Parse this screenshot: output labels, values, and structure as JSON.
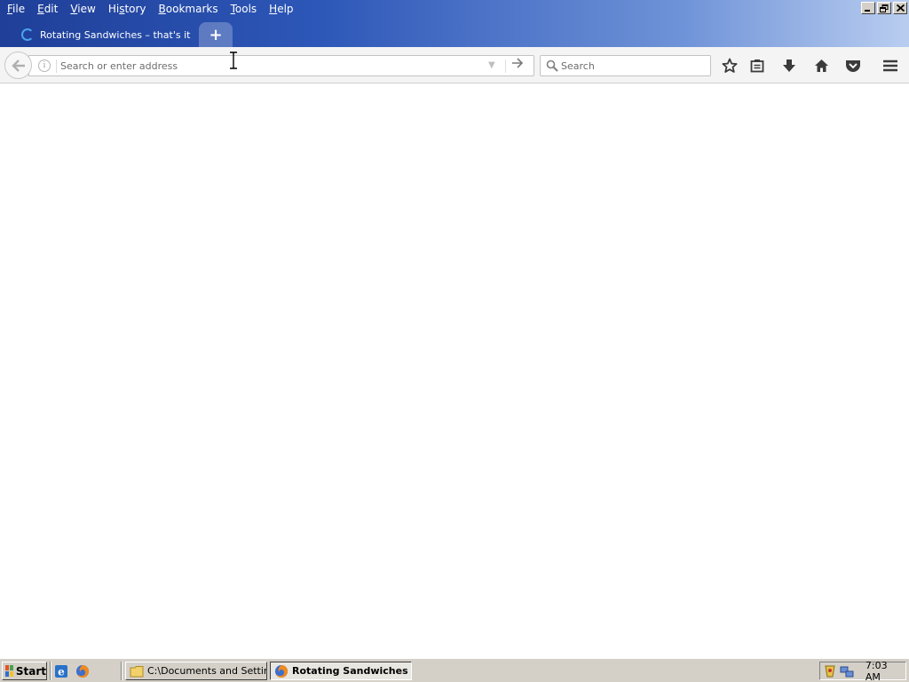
{
  "menubar": {
    "items": [
      {
        "pre": "",
        "acc": "F",
        "post": "ile"
      },
      {
        "pre": "",
        "acc": "E",
        "post": "dit"
      },
      {
        "pre": "",
        "acc": "V",
        "post": "iew"
      },
      {
        "pre": "Hi",
        "acc": "s",
        "post": "tory"
      },
      {
        "pre": "",
        "acc": "B",
        "post": "ookmarks"
      },
      {
        "pre": "",
        "acc": "T",
        "post": "ools"
      },
      {
        "pre": "",
        "acc": "H",
        "post": "elp"
      }
    ]
  },
  "tabs": {
    "active_title": "Rotating Sandwiches – that's it",
    "new_tab_symbol": "+"
  },
  "navbar": {
    "url_placeholder": "Search or enter address",
    "url_value": "",
    "search_placeholder": "Search",
    "search_value": ""
  },
  "taskbar": {
    "start_label": "Start",
    "tasks": [
      {
        "label": "C:\\Documents and Settin...",
        "active": false
      },
      {
        "label": "Rotating Sandwiches ...",
        "active": true
      }
    ],
    "clock": "7:03 AM"
  },
  "colors": {
    "title_gradient_start": "#1f3f98",
    "title_gradient_end": "#b9cdf0",
    "toolbar_bg": "#f4f4f4",
    "taskbar_bg": "#d4d0c8",
    "spinner": "#4aa3f0"
  },
  "icons": {
    "back": "back-arrow-icon",
    "info": "info-icon",
    "go": "go-arrow-icon",
    "search": "magnifier-icon",
    "bookmark": "star-icon",
    "library": "clipboard-icon",
    "downloads": "download-arrow-icon",
    "home": "house-icon",
    "pocket": "pocket-icon",
    "menu": "hamburger-icon"
  }
}
